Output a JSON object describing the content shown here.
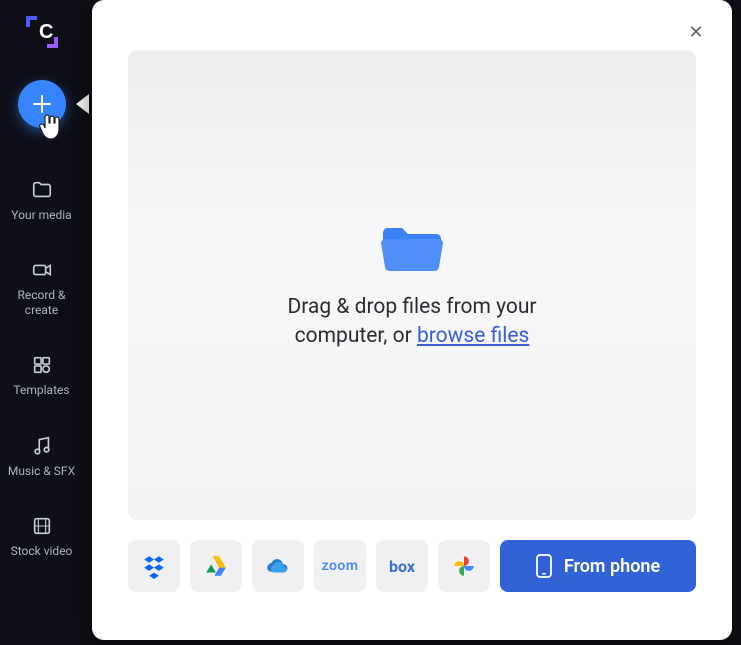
{
  "sidebar": {
    "items": [
      {
        "icon": "folder-icon",
        "label": "Your media"
      },
      {
        "icon": "camera-icon",
        "label": "Record & create"
      },
      {
        "icon": "templates-icon",
        "label": "Templates"
      },
      {
        "icon": "music-icon",
        "label": "Music & SFX"
      },
      {
        "icon": "stockvideo-icon",
        "label": "Stock video"
      }
    ]
  },
  "drop": {
    "line1": "Drag & drop files from your",
    "line2a": "computer, or ",
    "browse_link": "browse files"
  },
  "sources": {
    "dropbox_name": "dropbox-icon",
    "gdrive_name": "googledrive-icon",
    "onedrive_name": "onedrive-icon",
    "zoom_name": "zoom-icon",
    "zoom_label": "zoom",
    "box_name": "box-icon",
    "box_label": "box",
    "photos_name": "googlephotos-icon"
  },
  "primary_button_label": "From phone",
  "colors": {
    "accent": "#3784ff",
    "primary_button": "#3263d6"
  }
}
